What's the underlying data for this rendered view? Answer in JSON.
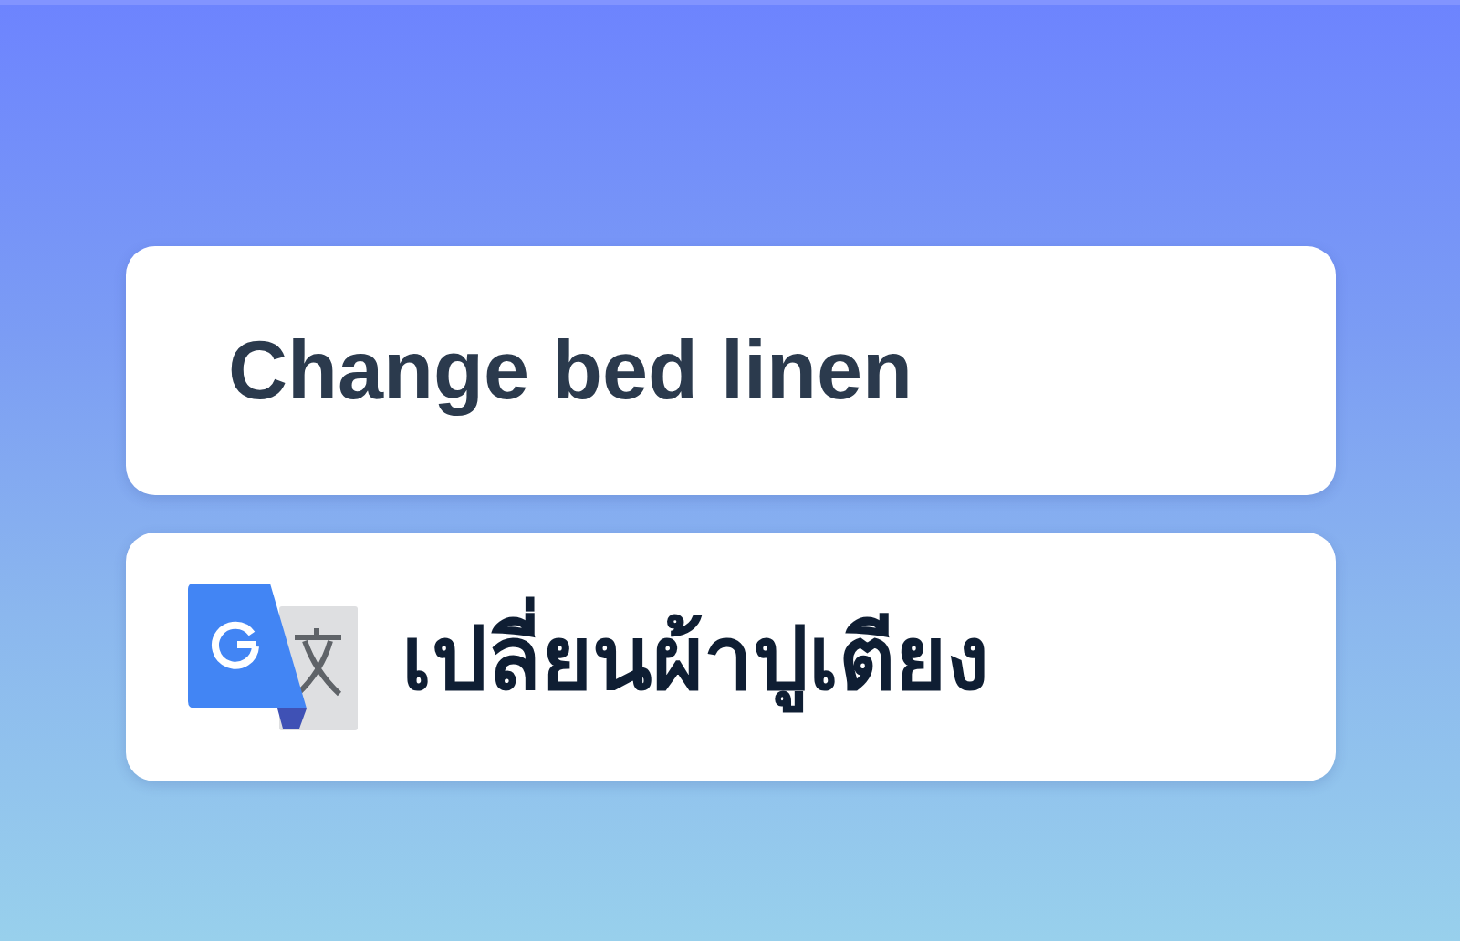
{
  "cards": [
    {
      "kind": "text",
      "text": "Change bed linen"
    },
    {
      "kind": "translation",
      "text": "เปลี่ยนผ้าปูเตียง"
    }
  ]
}
